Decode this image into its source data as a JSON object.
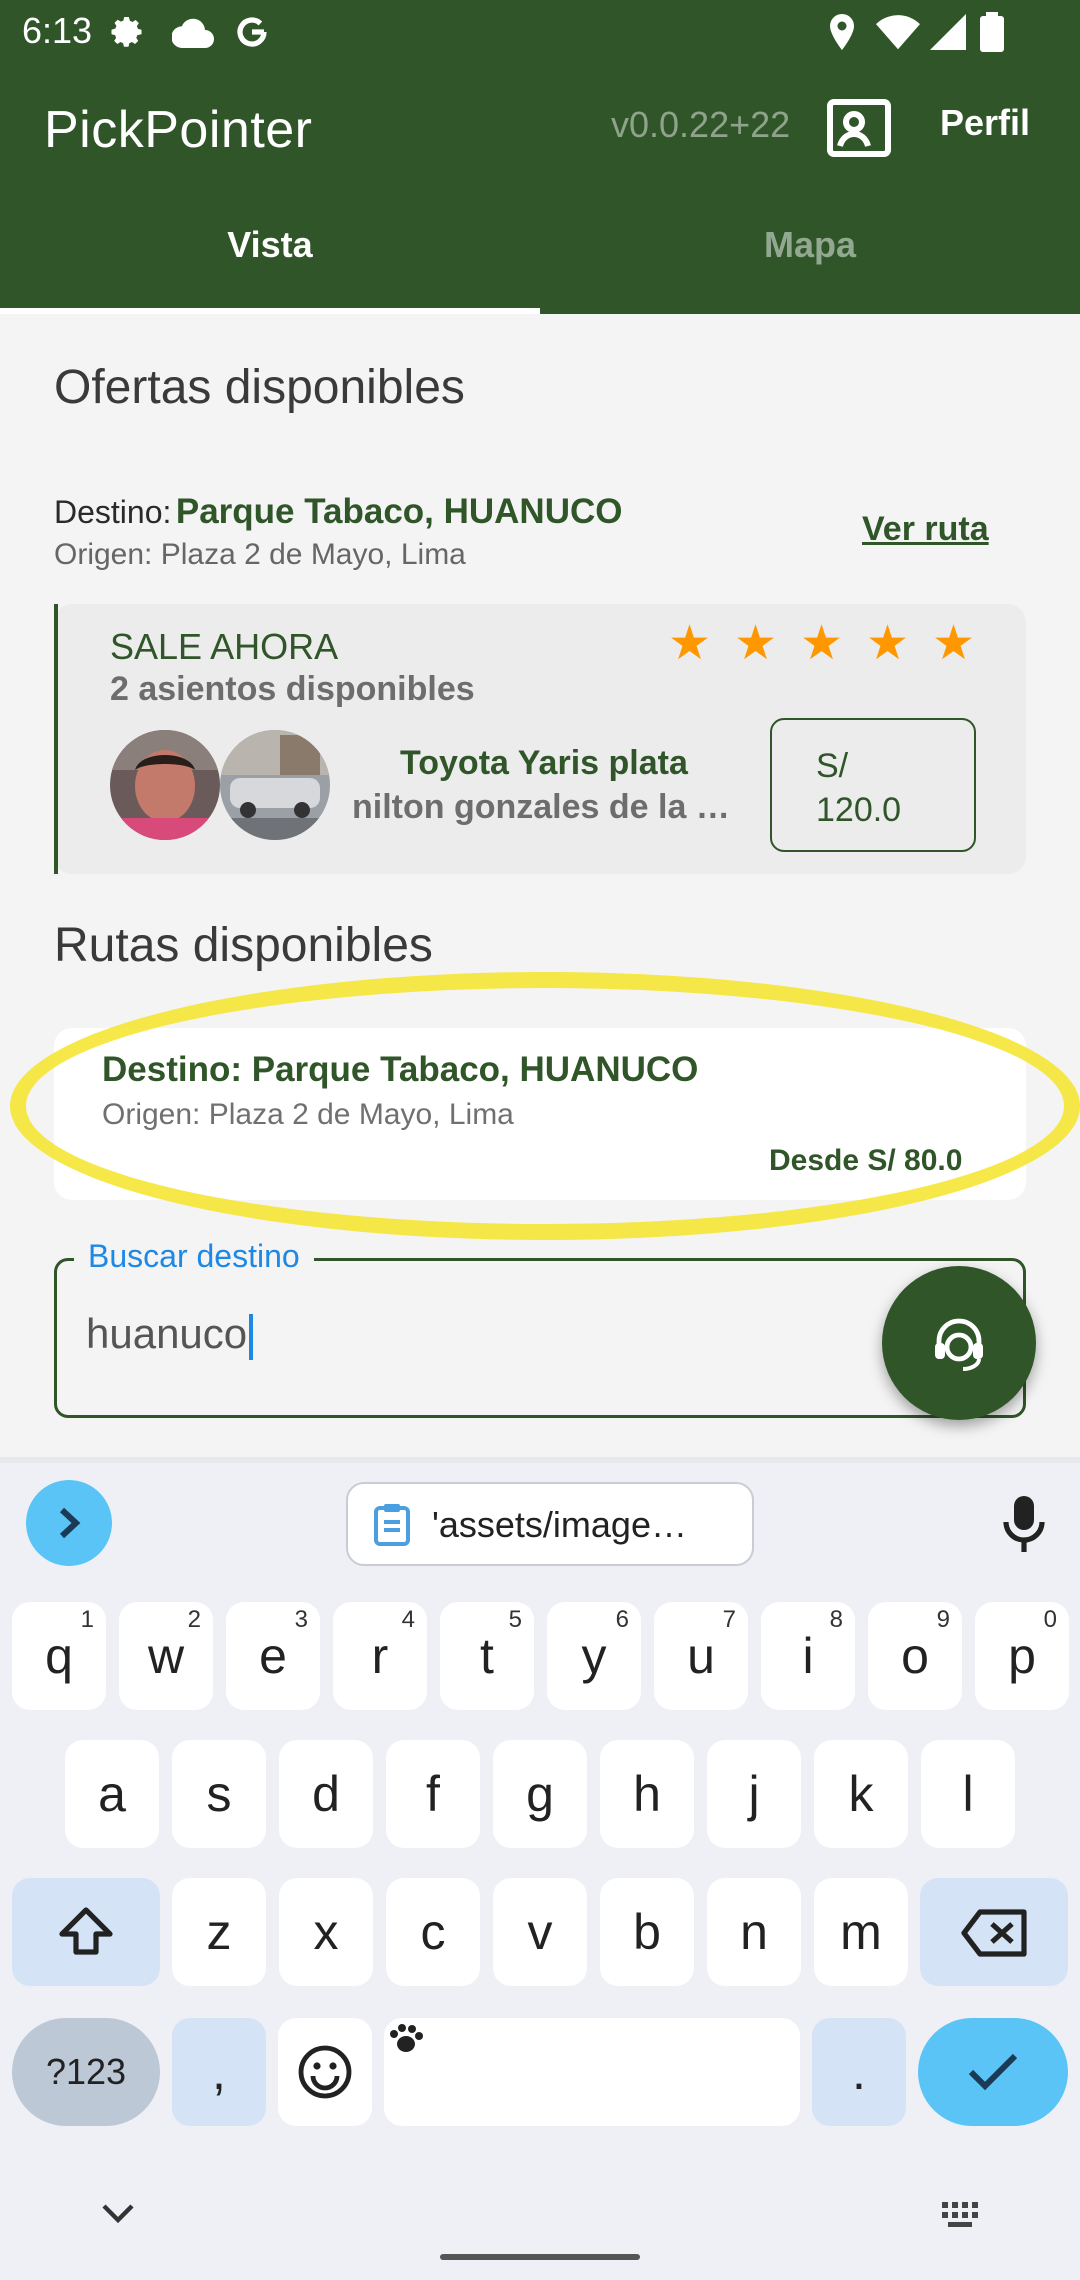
{
  "status_bar": {
    "time": "6:13"
  },
  "app": {
    "title": "PickPointer",
    "version": "v0.0.22+22",
    "perfil_label": "Perfil",
    "tabs": [
      "Vista",
      "Mapa"
    ],
    "active_tab": "Vista",
    "colors": {
      "primary": "#2f5528",
      "accent": "#1e88e5",
      "star": "#ff9800"
    }
  },
  "offers": {
    "heading": "Ofertas disponibles",
    "destino_label": "Destino:",
    "destino": "Parque Tabaco, HUANUCO",
    "origen": "Origen: Plaza 2 de Mayo, Lima",
    "ver_ruta": "Ver ruta",
    "card": {
      "status": "SALE AHORA",
      "seats": "2 asientos disponibles",
      "rating": 5,
      "car": "Toyota Yaris  plata",
      "driver": "nilton gonzales de la cruz",
      "price_currency": "S/",
      "price_value": "120.0"
    }
  },
  "routes": {
    "heading": "Rutas disponibles",
    "items": [
      {
        "destino": "Destino: Parque Tabaco, HUANUCO",
        "origen": "Origen: Plaza 2 de Mayo, Lima",
        "price": "Desde S/ 80.0"
      }
    ]
  },
  "search": {
    "label": "Buscar destino",
    "value": "huanuco"
  },
  "keyboard": {
    "clipboard_text": "'assets/image…",
    "row1": [
      {
        "k": "q",
        "s": "1"
      },
      {
        "k": "w",
        "s": "2"
      },
      {
        "k": "e",
        "s": "3"
      },
      {
        "k": "r",
        "s": "4"
      },
      {
        "k": "t",
        "s": "5"
      },
      {
        "k": "y",
        "s": "6"
      },
      {
        "k": "u",
        "s": "7"
      },
      {
        "k": "i",
        "s": "8"
      },
      {
        "k": "o",
        "s": "9"
      },
      {
        "k": "p",
        "s": "0"
      }
    ],
    "row2": [
      "a",
      "s",
      "d",
      "f",
      "g",
      "h",
      "j",
      "k",
      "l"
    ],
    "row3": [
      "z",
      "x",
      "c",
      "v",
      "b",
      "n",
      "m"
    ],
    "symbols_label": "?123",
    "comma": ",",
    "period": "."
  }
}
